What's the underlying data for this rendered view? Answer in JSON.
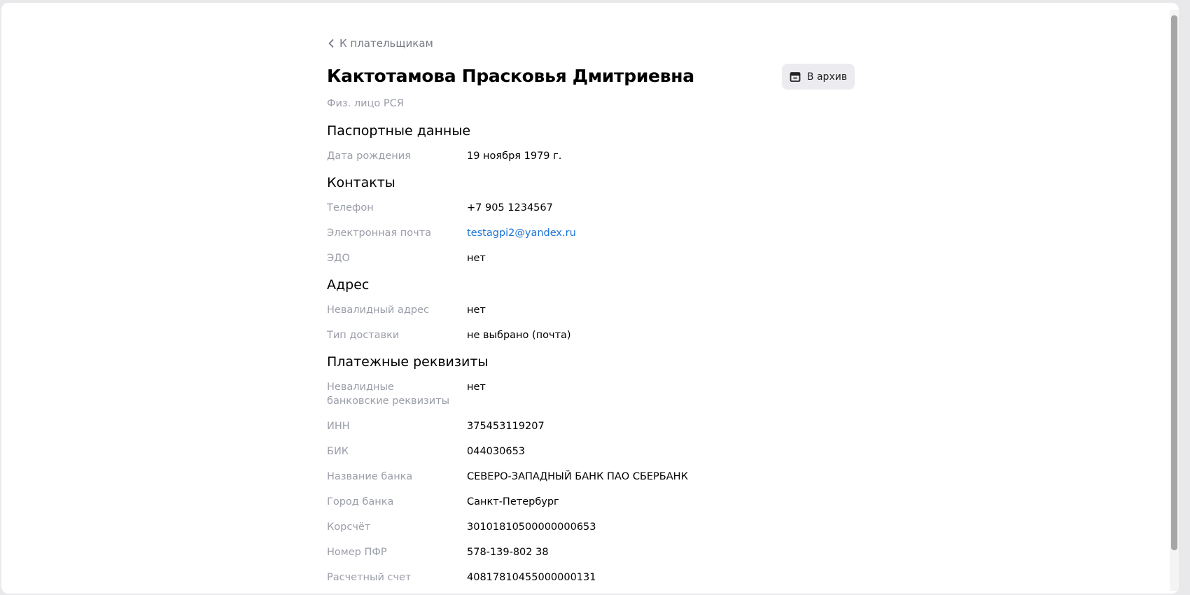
{
  "navigation": {
    "back_label": "К плательщикам"
  },
  "header": {
    "title": "Кактотамова Прасковья Дмитриевна",
    "subtitle": "Физ. лицо РСЯ",
    "archive_button_label": "В архив"
  },
  "sections": {
    "passport": {
      "title": "Паспортные данные",
      "birth_date_label": "Дата рождения",
      "birth_date_value": "19 ноября 1979 г."
    },
    "contacts": {
      "title": "Контакты",
      "phone_label": "Телефон",
      "phone_value": "+7 905 1234567",
      "email_label": "Электронная почта",
      "email_value": "testagpi2@yandex.ru",
      "edo_label": "ЭДО",
      "edo_value": "нет"
    },
    "address": {
      "title": "Адрес",
      "invalid_address_label": "Невалидный адрес",
      "invalid_address_value": "нет",
      "delivery_type_label": "Тип доставки",
      "delivery_type_value": "не выбрано (почта)"
    },
    "payment": {
      "title": "Платежные реквизиты",
      "invalid_bank_label": "Невалидные банковские реквизиты",
      "invalid_bank_value": "нет",
      "inn_label": "ИНН",
      "inn_value": "375453119207",
      "bik_label": "БИК",
      "bik_value": "044030653",
      "bank_name_label": "Название банка",
      "bank_name_value": "СЕВЕРО-ЗАПАДНЫЙ БАНК ПАО СБЕРБАНК",
      "bank_city_label": "Город банка",
      "bank_city_value": "Санкт-Петербург",
      "corr_account_label": "Корсчёт",
      "corr_account_value": "30101810500000000653",
      "pfr_label": "Номер ПФР",
      "pfr_value": "578-139-802 38",
      "account_label": "Расчетный счет",
      "account_value": "40817810455000000131"
    }
  },
  "colors": {
    "background": "#ffffff",
    "label_gray": "#9a9ea8",
    "link_blue": "#1a73d9",
    "button_bg": "#ececf0"
  },
  "icons": {
    "back": "chevron-left-icon",
    "archive": "archive-icon"
  }
}
